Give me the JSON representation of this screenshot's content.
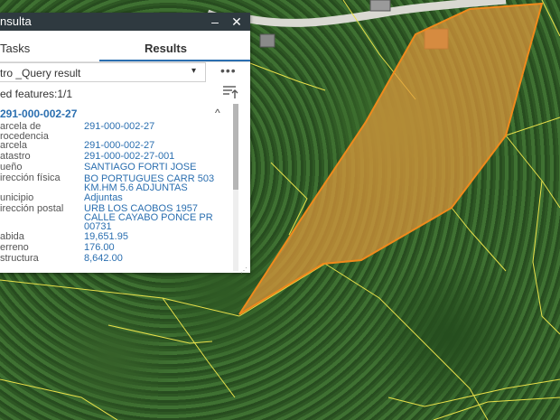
{
  "window": {
    "title": "nsulta",
    "minimize_glyph": "–",
    "close_glyph": "✕"
  },
  "tabs": [
    {
      "label": "Tasks"
    },
    {
      "label": "Results"
    }
  ],
  "layer_select": {
    "value": "tro _Query result",
    "caret": "▾"
  },
  "more_menu": {
    "label": "•••"
  },
  "features": {
    "count_text": "ed features:1/1"
  },
  "record": {
    "title": "291-000-002-27",
    "collapse_glyph": "^",
    "fields": [
      {
        "label": "arcela de\nrocedencia",
        "value": "291-000-002-27"
      },
      {
        "label": "arcela",
        "value": "291-000-002-27"
      },
      {
        "label": "atastro",
        "value": "291-000-002-27-001"
      },
      {
        "label": "ueño",
        "value": "SANTIAGO FORTI JOSE"
      },
      {
        "label": "irección física",
        "value": "BO PORTUGUES CARR 503\nKM.HM 5.6 ADJUNTAS"
      },
      {
        "label": "unicipio",
        "value": "Adjuntas"
      },
      {
        "label": "irección postal",
        "value": "URB LOS CAOBOS 1957\nCALLE CAYABO PONCE PR\n00731"
      },
      {
        "label": "abida",
        "value": "19,651.95"
      },
      {
        "label": "erreno",
        "value": "176.00"
      },
      {
        "label": "structura",
        "value": "8,642.00"
      }
    ]
  },
  "map": {
    "parcel_fill": "#e59a3c",
    "parcel_stroke": "#f08a1c",
    "line_color": "#e8e04a",
    "road_color": "#d9d9d2"
  },
  "colors": {
    "accent": "#2b6fb0",
    "titlebar": "#2f3a40"
  }
}
